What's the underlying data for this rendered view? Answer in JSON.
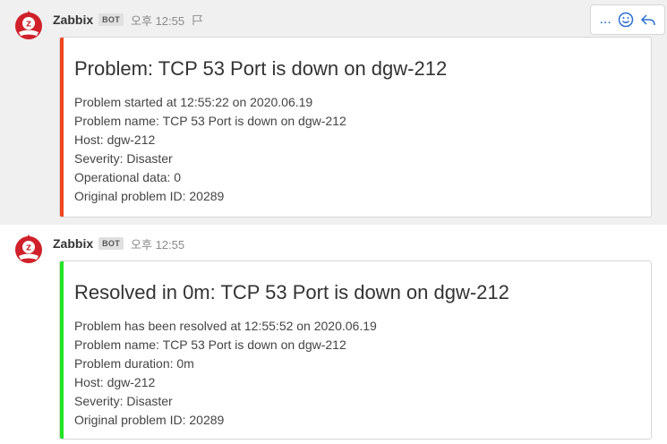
{
  "colors": {
    "problem_bar": "#f0461e",
    "resolved_bar": "#21e521",
    "accent": "#2a6fd0"
  },
  "posts": [
    {
      "username": "Zabbix",
      "badge": "BOT",
      "time": "오후 12:55",
      "actions": {
        "more": "...",
        "emoji_icon": "smiley-icon",
        "reply_icon": "reply-icon"
      },
      "attachment": {
        "title": "Problem: TCP 53 Port is down on dgw-212",
        "lines": [
          "Problem started at 12:55:22 on 2020.06.19",
          "Problem name: TCP 53 Port is down on dgw-212",
          "Host: dgw-212",
          "Severity: Disaster",
          "Operational data: 0",
          "Original problem ID: 20289"
        ]
      }
    },
    {
      "username": "Zabbix",
      "badge": "BOT",
      "time": "오후 12:55",
      "attachment": {
        "title": "Resolved in 0m: TCP 53 Port is down on dgw-212",
        "lines": [
          "Problem has been resolved at 12:55:52 on 2020.06.19",
          "Problem name: TCP 53 Port is down on dgw-212",
          "Problem duration: 0m",
          "Host: dgw-212",
          "Severity: Disaster",
          "Original problem ID: 20289"
        ]
      }
    }
  ]
}
